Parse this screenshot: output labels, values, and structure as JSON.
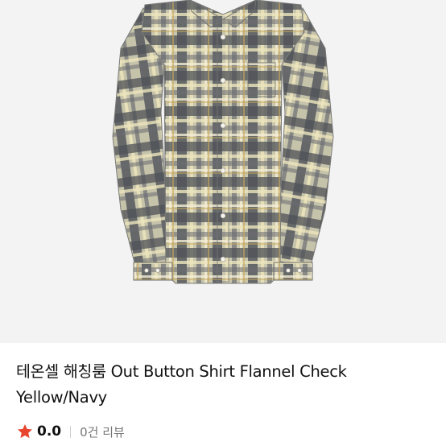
{
  "product": {
    "image_alt": "Out Button Shirt Flannel Check Yellow/Navy",
    "title_line1": "테온셀 해칭룸 Out Button Shirt Flannel Check",
    "title_line2": "Yellow/Navy",
    "rating": "0.0",
    "review_count_label": "0건 리뷰"
  },
  "colors": {
    "background": "#ffffff",
    "image_bg": "#f3f3f3",
    "star": "#e8442e",
    "text": "#111111",
    "muted": "#777777"
  },
  "icons": {
    "rating": "star-icon"
  }
}
